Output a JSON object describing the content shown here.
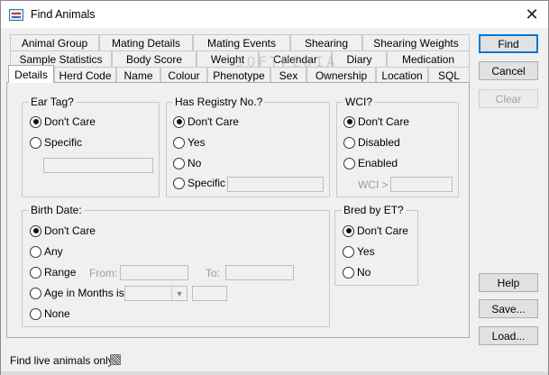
{
  "window": {
    "title": "Find Animals",
    "close_glyph": "✕",
    "icon": "form-icon"
  },
  "tabs": {
    "row1": [
      "Animal Group",
      "Mating Details",
      "Mating Events",
      "Shearing",
      "Shearing Weights"
    ],
    "row2": [
      "Sample Statistics",
      "Body Score",
      "Weight",
      "Calendar",
      "Diary",
      "Medication"
    ],
    "row3": [
      "Details",
      "Herd Code",
      "Name",
      "Colour",
      "Phenotype",
      "Sex",
      "Ownership",
      "Location",
      "SQL"
    ],
    "active": "Details"
  },
  "groups": {
    "ear_tag": {
      "label": "Ear Tag?",
      "options": [
        "Don't Care",
        "Specific"
      ],
      "selected": "Don't Care"
    },
    "registry": {
      "label": "Has Registry No.?",
      "options": [
        "Don't Care",
        "Yes",
        "No",
        "Specific"
      ],
      "selected": "Don't Care"
    },
    "wci": {
      "label": "WCI?",
      "options": [
        "Don't Care",
        "Disabled",
        "Enabled"
      ],
      "selected": "Don't Care",
      "threshold_label": "WCI >"
    },
    "birth_date": {
      "label": "Birth Date:",
      "options": [
        "Don't Care",
        "Any",
        "Range",
        "Age in Months is",
        "None"
      ],
      "selected": "Don't Care",
      "from_label": "From:",
      "to_label": "To:"
    },
    "bred_by_et": {
      "label": "Bred by ET?",
      "options": [
        "Don't Care",
        "Yes",
        "No"
      ],
      "selected": "Don't Care"
    }
  },
  "buttons": {
    "find": "Find",
    "cancel": "Cancel",
    "clear": "Clear",
    "help": "Help",
    "save": "Save...",
    "load": "Load..."
  },
  "footer": {
    "live_only_label": "Find live animals only?"
  },
  "watermark": "SOFTPEDIA",
  "colors": {
    "default_button_border": "#0078d7",
    "panel_bg": "#f0f0f0"
  }
}
